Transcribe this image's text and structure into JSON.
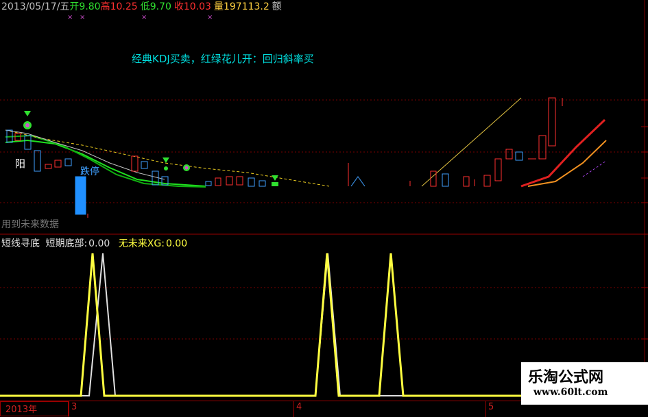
{
  "header": {
    "date": "2013/05/17/五",
    "open_label": "开",
    "open_value": "9.80",
    "high_label": "高",
    "high_value": "10.25",
    "low_label": "低",
    "low_value": "9.70",
    "close_label": "收",
    "close_value": "10.03",
    "volume_label": "量",
    "volume_value": "197113.2",
    "amount_label": "额"
  },
  "formula_title": "经典KDJ买卖，红绿花儿开：回归斜率买",
  "annotations": {
    "yang": "阳",
    "limit_down": "跌停",
    "future_data": "用到未来数据"
  },
  "sub_indicator": {
    "name": "短线寻底",
    "field1_label": "短期底部:",
    "field1_value": "0.00",
    "field2_label": "无未来XG:",
    "field2_value": "0.00"
  },
  "axis": {
    "year_label": "2013年",
    "month_ticks": [
      "3",
      "4",
      "5"
    ]
  },
  "watermark": {
    "title": "乐淘公式网",
    "url": "www.60lt.com"
  },
  "colors": {
    "up": "#ff3030",
    "down": "#40a0ff",
    "ma_green": "#00d000",
    "ma_yellow": "#f0e000",
    "signal_yellow": "#ffff40",
    "signal_white": "#e0e0e0"
  }
}
